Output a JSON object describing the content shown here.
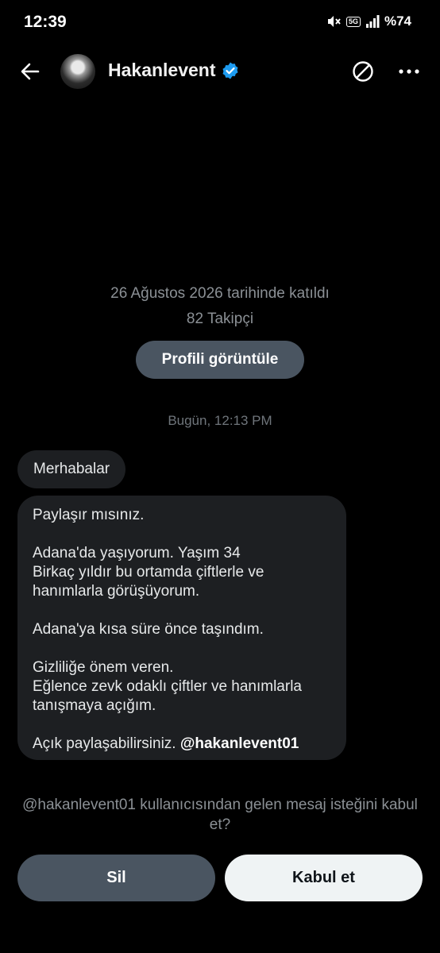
{
  "status_bar": {
    "time": "12:39",
    "network": "5G",
    "battery": "%74",
    "icons": [
      "mute-icon",
      "signal-icon",
      "battery-icon"
    ]
  },
  "header": {
    "name": "Hakanlevent",
    "verified": true,
    "icons": [
      "back-arrow-icon",
      "verified-badge-icon",
      "block-icon",
      "more-icon"
    ]
  },
  "profile": {
    "joined": "26 Ağustos 2026 tarihinde katıldı",
    "followers": "82 Takipçi",
    "view_profile_label": "Profili görüntüle"
  },
  "conversation": {
    "timestamp": "Bugün, 12:13 PM",
    "messages": [
      {
        "text": "Merhabalar"
      },
      {
        "lines": [
          "Paylaşır mısınız.",
          "",
          "Adana'da yaşıyorum. Yaşım 34",
          "Birkaç yıldır bu ortamda çiftlerle ve",
          "hanımlarla görüşüyorum.",
          "",
          "Adana'ya kısa süre önce taşındım.",
          "",
          "Gizliliğe önem veren.",
          "Eğlence zevk odaklı çiftler ve hanımlarla",
          "tanışmaya açığım.",
          ""
        ],
        "last_line_text": "Açık paylaşabilirsiniz.",
        "mention": "@hakanlevent01"
      }
    ]
  },
  "request": {
    "prompt": "@hakanlevent01 kullanıcısından gelen mesaj isteğini kabul et?",
    "delete_label": "Sil",
    "accept_label": "Kabul et"
  },
  "colors": {
    "background": "#000000",
    "bubble": "#1d1f22",
    "secondary_button": "#4a5561",
    "primary_button": "#eff3f4",
    "verified": "#1d9bf0",
    "muted_text": "#8b9095"
  }
}
